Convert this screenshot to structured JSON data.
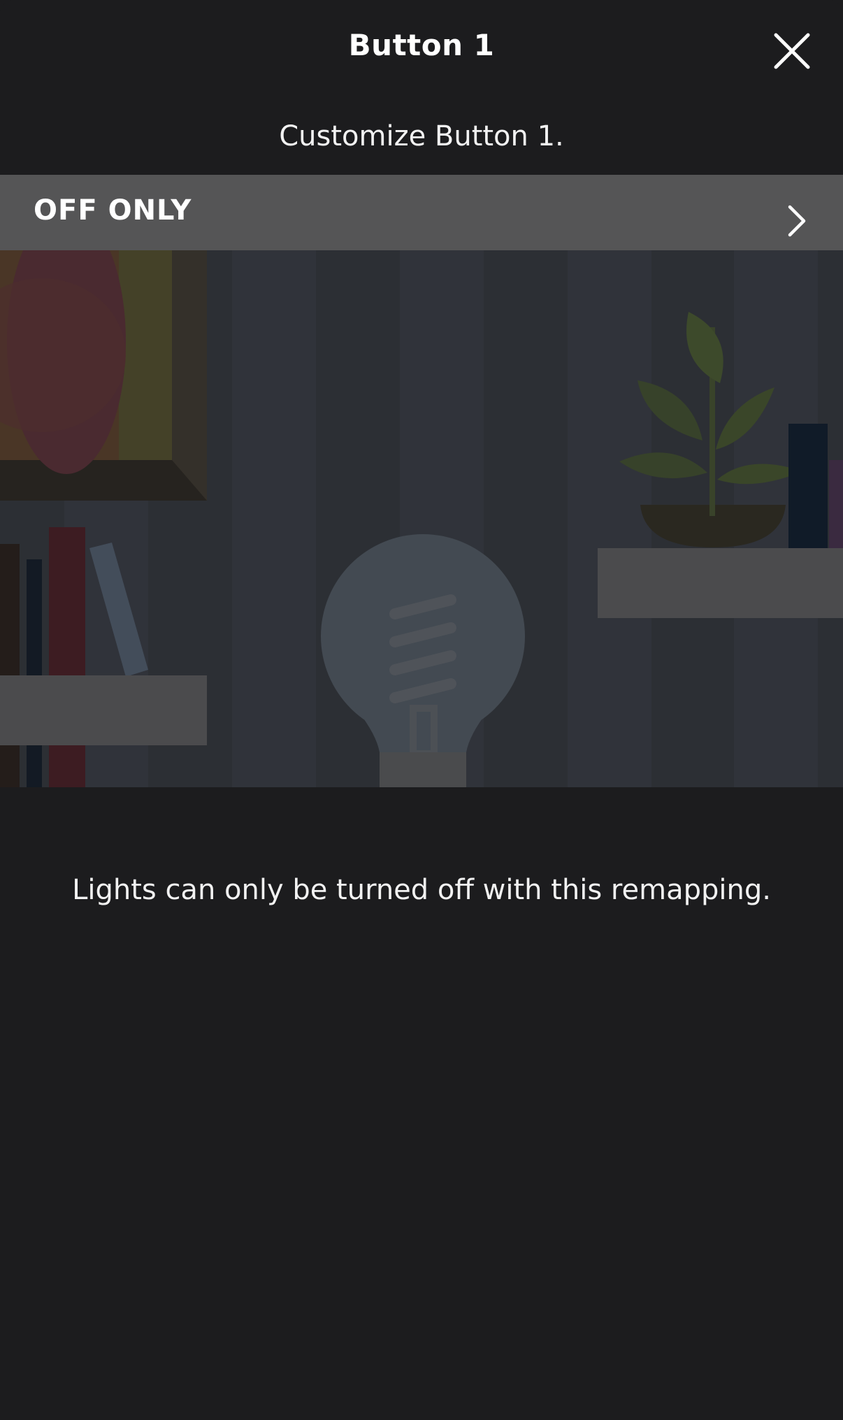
{
  "header": {
    "title": "Button 1",
    "close_icon": "close-icon"
  },
  "subtitle": "Customize Button 1.",
  "mode_selector": {
    "value": "OFF ONLY",
    "chevron_icon": "chevron-right-icon"
  },
  "illustration": {
    "icon": "shelf-scene-illustration",
    "description": ""
  },
  "description": "Lights can only be turned off with this remapping.",
  "colors": {
    "background": "#1c1c1e",
    "row_background": "#555556",
    "text": "#ffffff"
  }
}
